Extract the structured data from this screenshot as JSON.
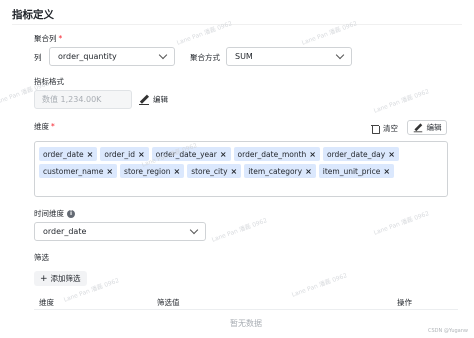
{
  "title": "指标定义",
  "aggregate": {
    "label": "聚合列",
    "required_mark": "*",
    "column_label": "列",
    "column_value": "order_quantity",
    "method_label": "聚合方式",
    "method_value": "SUM"
  },
  "format": {
    "label": "指标格式",
    "preview": "数值 1,234.00K",
    "edit_label": "编辑"
  },
  "dimensions": {
    "label": "维度",
    "required_mark": "*",
    "clear_label": "清空",
    "edit_label": "编辑",
    "row1": [
      "order_date",
      "order_id",
      "order_date_year",
      "order_date_month",
      "order_date_day"
    ],
    "row2": [
      "customer_name",
      "store_region",
      "store_city",
      "item_category",
      "item_unit_price"
    ]
  },
  "time_dimension": {
    "label": "时间维度",
    "info_icon": "i",
    "value": "order_date"
  },
  "filter": {
    "label": "筛选",
    "add_label": "添加筛选",
    "columns": [
      "维度",
      "筛选值",
      "操作"
    ],
    "empty_text": "暂无数据"
  },
  "watermark_text": "Lane Pan 潘磊 0962",
  "credit": "CSDN @Yuganw"
}
